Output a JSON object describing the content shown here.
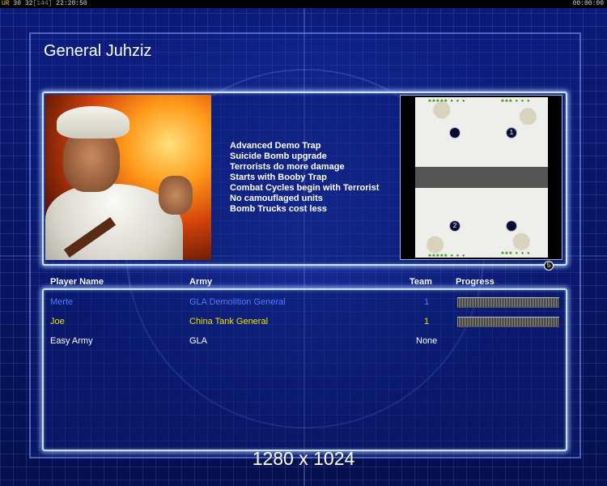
{
  "hud": {
    "stats_prefix": "UR",
    "fps": "30 32",
    "fps_avg": "[144]",
    "clock": "22:20:50",
    "timer": "00:00:00"
  },
  "screen": {
    "title": "General Juhziz",
    "resolution_label": "1280 x 1024"
  },
  "general": {
    "bonuses": [
      "Advanced Demo Trap",
      "Suicide Bomb upgrade",
      "Terrorists do more damage",
      "Starts with Booby Trap",
      "Combat Cycles begin with Terrorist",
      "No camouflaged units",
      "Bomb Trucks cost less"
    ]
  },
  "map": {
    "start_positions": [
      "1",
      "2",
      "",
      ""
    ],
    "player_count_badge": "5"
  },
  "table": {
    "headers": {
      "player_name": "Player Name",
      "army": "Army",
      "team": "Team",
      "progress": "Progress"
    },
    "rows": [
      {
        "name": "Merte",
        "army": "GLA Demolition General",
        "team": "1",
        "color": "#4b7bff",
        "progress": 1.0
      },
      {
        "name": "Joe",
        "army": "China Tank General",
        "team": "1",
        "color": "#f0e000",
        "progress": 1.0
      },
      {
        "name": "Easy Army",
        "army": "GLA",
        "team": "None",
        "color": "#ffffff",
        "progress": null
      }
    ]
  }
}
